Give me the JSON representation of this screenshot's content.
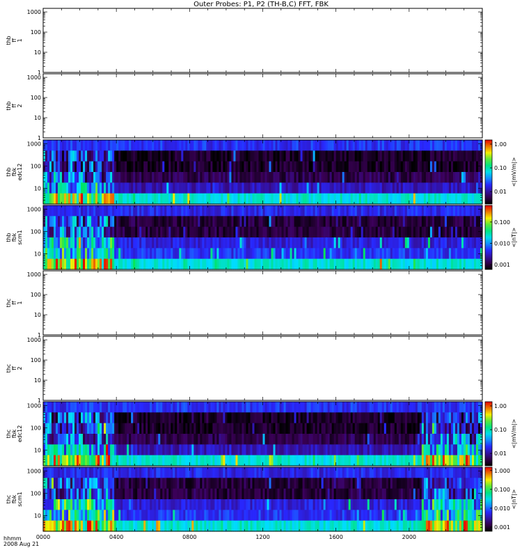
{
  "title": "Outer Probes: P1, P2 (TH-B,C) FFT, FBK",
  "time_axis": {
    "label": "hhmm",
    "date": "2008 Aug 21",
    "ticks": [
      "0000",
      "0400",
      "0800",
      "1200",
      "1600",
      "2000"
    ]
  },
  "chart_data": [
    {
      "type": "heatmap",
      "name": "thb ff 1",
      "ylabel": [
        "thb",
        "ff",
        "1"
      ],
      "scale": "log",
      "y_ticks": [
        "1",
        "10",
        "100",
        "1000"
      ],
      "ylim": [
        1,
        1500
      ],
      "has_data": false
    },
    {
      "type": "heatmap",
      "name": "thb ff 2",
      "ylabel": [
        "thb",
        "ff",
        "2"
      ],
      "scale": "log",
      "y_ticks": [
        "1",
        "10",
        "100",
        "1000"
      ],
      "ylim": [
        1,
        1500
      ],
      "has_data": false
    },
    {
      "type": "heatmap",
      "name": "thb fbk edc12",
      "ylabel": [
        "thb",
        "fbk",
        "edc12"
      ],
      "scale": "log",
      "y_ticks": [
        "10",
        "100",
        "1000"
      ],
      "ylim": [
        2,
        1500
      ],
      "has_data": true,
      "colorbar": {
        "label": "<|mV/m|>",
        "ticks": [
          "1.00",
          "0.10",
          "0.01"
        ],
        "range": [
          0.003,
          1.5
        ]
      },
      "bands": 6
    },
    {
      "type": "heatmap",
      "name": "thb fbk scm1",
      "ylabel": [
        "thb",
        "fbk",
        "scm1"
      ],
      "scale": "log",
      "y_ticks": [
        "10",
        "100",
        "1000"
      ],
      "ylim": [
        2,
        1500
      ],
      "has_data": true,
      "colorbar": {
        "label": "<|nT|>",
        "ticks": [
          "0.100",
          "0.010",
          "0.001"
        ],
        "range": [
          0.0006,
          0.6
        ]
      },
      "bands": 6
    },
    {
      "type": "heatmap",
      "name": "thc ff 1",
      "ylabel": [
        "thc",
        "ff",
        "1"
      ],
      "scale": "log",
      "y_ticks": [
        "1",
        "10",
        "100",
        "1000"
      ],
      "ylim": [
        1,
        1500
      ],
      "has_data": false
    },
    {
      "type": "heatmap",
      "name": "thc ff 2",
      "ylabel": [
        "thc",
        "ff",
        "2"
      ],
      "scale": "log",
      "y_ticks": [
        "1",
        "10",
        "100",
        "1000"
      ],
      "ylim": [
        1,
        1500
      ],
      "has_data": false
    },
    {
      "type": "heatmap",
      "name": "thc fbk edc12",
      "ylabel": [
        "thc",
        "fbk",
        "edc12"
      ],
      "scale": "log",
      "y_ticks": [
        "10",
        "100",
        "1000"
      ],
      "ylim": [
        2,
        1500
      ],
      "has_data": true,
      "colorbar": {
        "label": "<|mV/m|>",
        "ticks": [
          "1.00",
          "0.10",
          "0.01"
        ],
        "range": [
          0.003,
          1.5
        ]
      },
      "bands": 6
    },
    {
      "type": "heatmap",
      "name": "thc fbk scm1",
      "ylabel": [
        "thc",
        "fbk",
        "scm1"
      ],
      "scale": "log",
      "y_ticks": [
        "10",
        "100",
        "1000"
      ],
      "ylim": [
        2,
        1500
      ],
      "has_data": true,
      "colorbar": {
        "label": "<|nT|>",
        "ticks": [
          "1.000",
          "0.100",
          "0.010",
          "0.001"
        ],
        "range": [
          0.0006,
          1.5
        ]
      },
      "bands": 6
    }
  ]
}
